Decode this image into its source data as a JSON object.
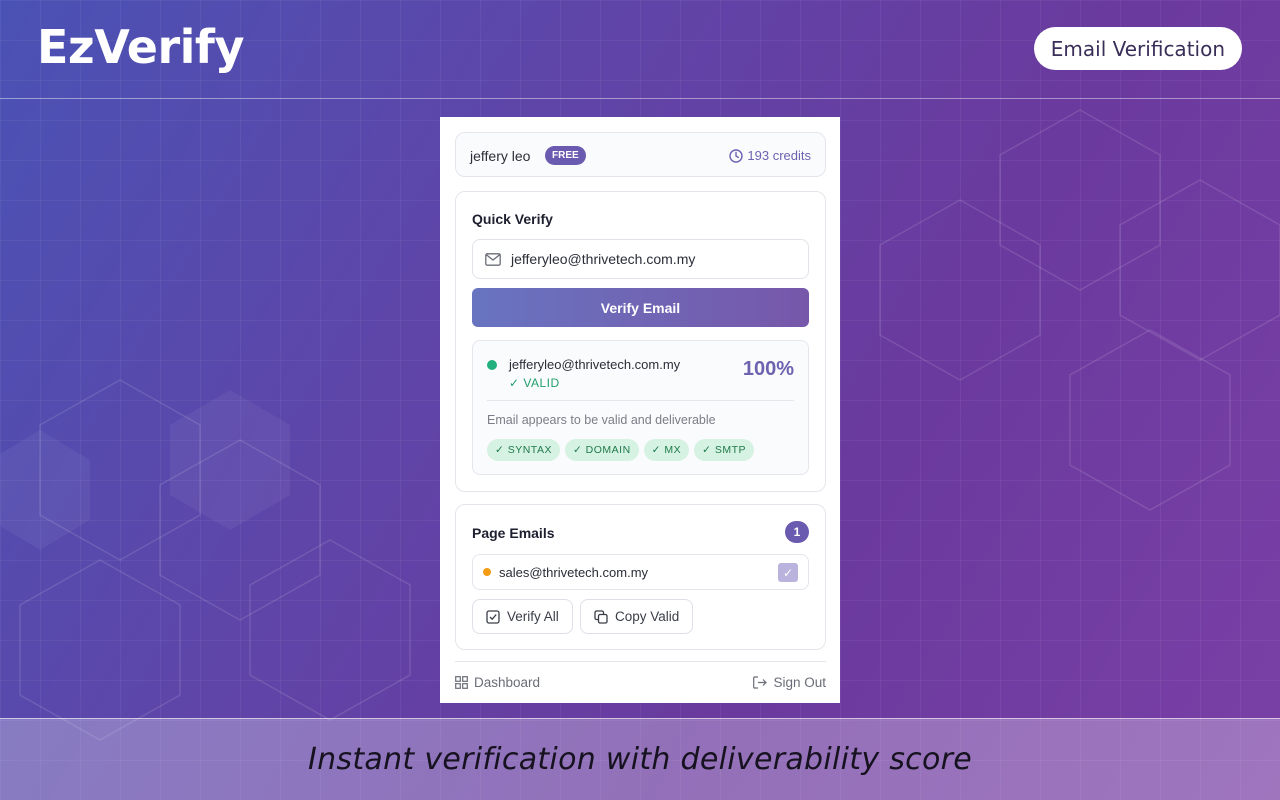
{
  "brand": {
    "logo_text": "EzVerify",
    "tag_label": "Email Verification"
  },
  "user": {
    "name": "jeffery leo",
    "plan_badge": "FREE",
    "credits": "193 credits"
  },
  "quick_verify": {
    "title": "Quick Verify",
    "input_value": "jefferyleo@thrivetech.com.my",
    "button_label": "Verify Email",
    "result": {
      "email": "jefferyleo@thrivetech.com.my",
      "status": "✓ VALID",
      "score": "100%",
      "message": "Email appears to be valid and deliverable",
      "checks": [
        "✓ SYNTAX",
        "✓ DOMAIN",
        "✓ MX",
        "✓ SMTP"
      ]
    }
  },
  "page_emails": {
    "title": "Page Emails",
    "count": "1",
    "items": [
      {
        "email": "sales@thrivetech.com.my",
        "checked": true
      }
    ],
    "verify_all_label": "Verify All",
    "copy_valid_label": "Copy Valid"
  },
  "footer": {
    "dashboard_label": "Dashboard",
    "sign_out_label": "Sign Out"
  },
  "caption": "Instant verification with deliverability score",
  "colors": {
    "accent": "#6b5bb0",
    "valid_dot": "#22b07d",
    "pending_dot": "#f39c12",
    "chip_bg": "#d6f2e2"
  }
}
